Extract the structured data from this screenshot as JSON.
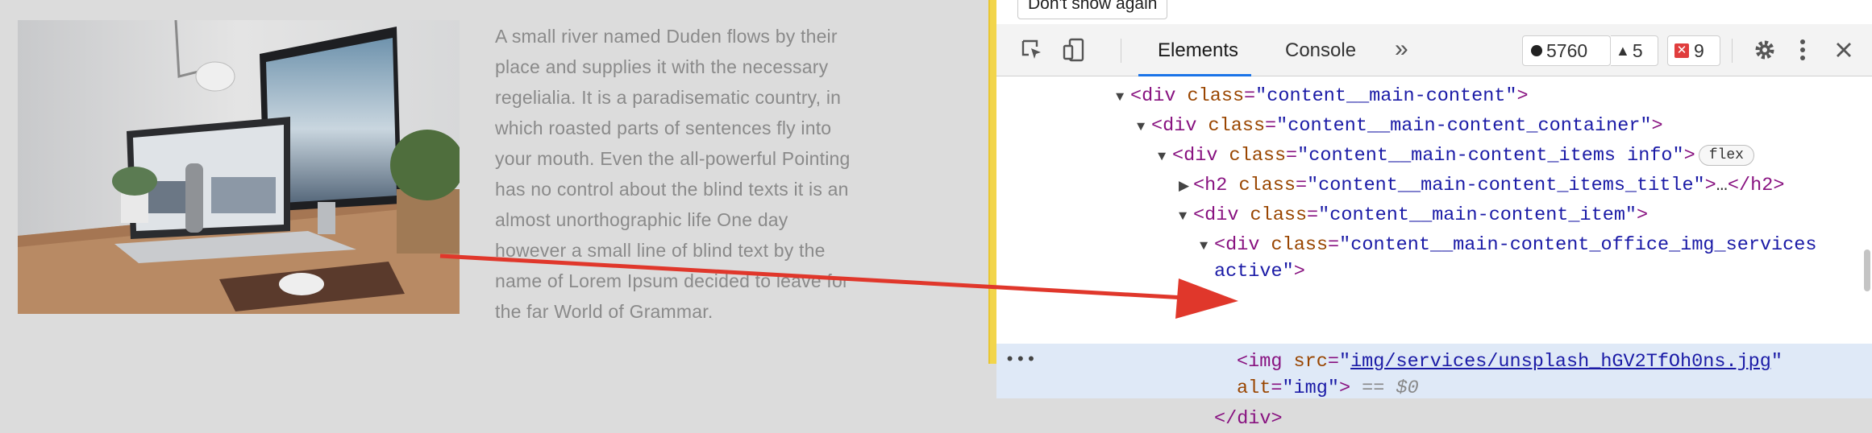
{
  "article": {
    "lines": [
      "A small river named Duden flows by their",
      "place and supplies it with the necessary",
      "regelialia. It is a paradisematic country, in",
      "which roasted parts of sentences fly into",
      "your mouth. Even the all-powerful Pointing",
      "has no control about the blind texts it is an",
      "almost unorthographic life One day",
      "however a small line of blind text by the",
      "name of Lorem Ipsum decided to leave for",
      "the far World of Grammar."
    ]
  },
  "devtools": {
    "dont_show_label": "Don't show again",
    "tabs": {
      "elements": "Elements",
      "console": "Console",
      "more": "»"
    },
    "badges": {
      "messages": "5760",
      "warnings": "5",
      "errors": "9"
    },
    "tree": {
      "tag_div": "div",
      "tag_h2": "h2",
      "tag_img": "img",
      "attr_class": "class",
      "attr_src": "src",
      "attr_alt": "alt",
      "class_main_content": "\"content__main-content\"",
      "class_container": "\"content__main-content_container\"",
      "class_items_info": "\"content__main-content_items info\"",
      "flex_badge": "flex",
      "class_items_title": "\"content__main-content_items_title\"",
      "collapsed": "…",
      "class_item": "\"content__main-content_item\"",
      "class_office_img": "\"content__main-content_office_img_services",
      "class_office_img_cont": "active\"",
      "img_src": "img/services/unsplash_hGV2TfOh0ns.jpg",
      "img_alt": "\"img\"",
      "selected_marker": "== $0",
      "closing_div": "</div>"
    }
  },
  "annotation": {
    "arrow_color": "#e0372b"
  }
}
